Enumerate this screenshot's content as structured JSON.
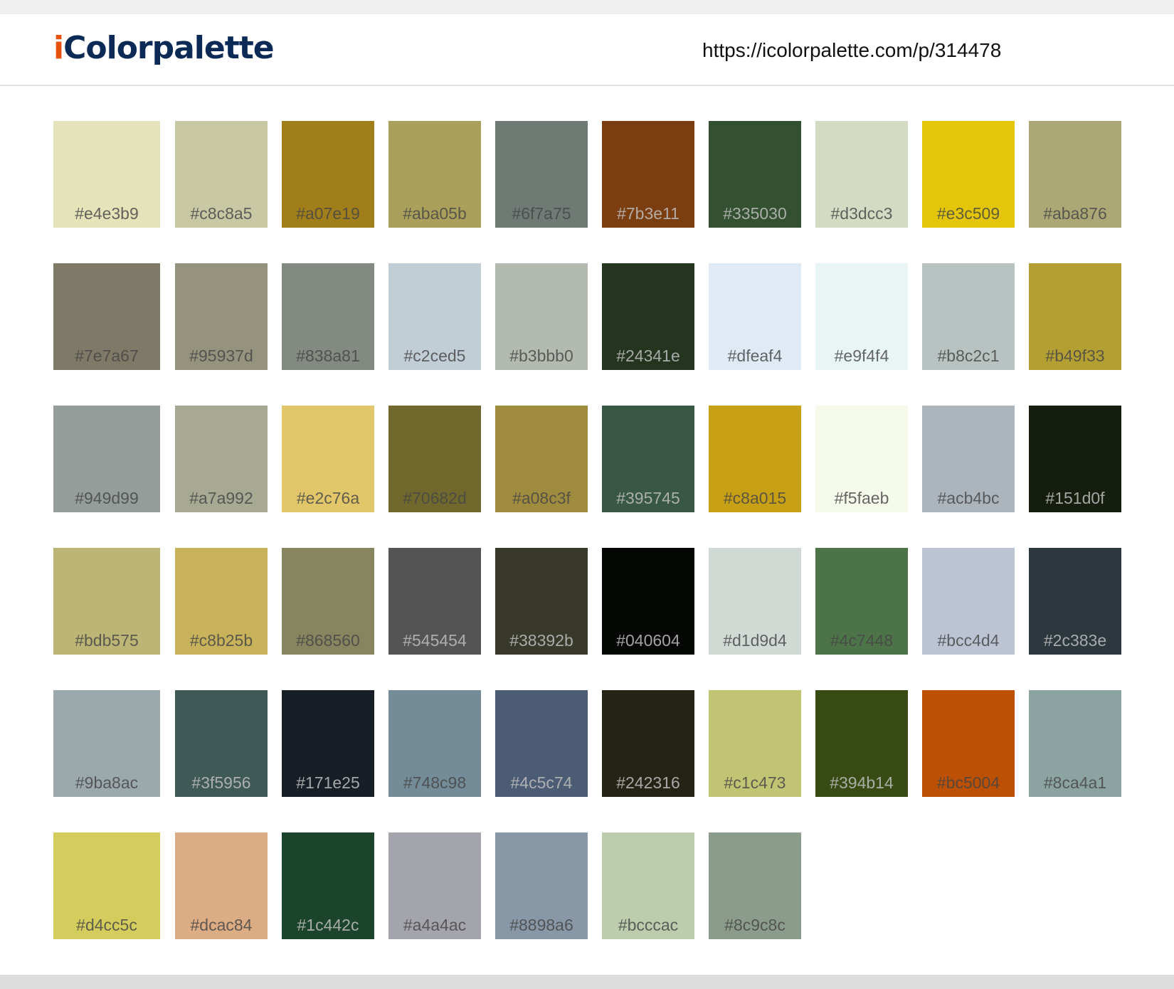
{
  "header": {
    "logo_first": "i",
    "logo_rest": "Colorpalette",
    "url": "https://icolorpalette.com/p/314478"
  },
  "colors": {
    "logo_accent": "#e8520f",
    "logo_main": "#0b2a55"
  },
  "swatches": [
    "#e4e3b9",
    "#c8c8a5",
    "#a07e19",
    "#aba05b",
    "#6f7a75",
    "#7b3e11",
    "#335030",
    "#d3dcc3",
    "#e3c509",
    "#aba876",
    "#7e7a67",
    "#95937d",
    "#838a81",
    "#c2ced5",
    "#b3bbb0",
    "#24341e",
    "#dfeaf4",
    "#e9f4f4",
    "#b8c2c1",
    "#b49f33",
    "#949d99",
    "#a7a992",
    "#e2c76a",
    "#70682d",
    "#a08c3f",
    "#395745",
    "#c8a015",
    "#f5faeb",
    "#acb4bc",
    "#151d0f",
    "#bdb575",
    "#c8b25b",
    "#868560",
    "#545454",
    "#38392b",
    "#040604",
    "#d1d9d4",
    "#4c7448",
    "#bcc4d4",
    "#2c383e",
    "#9ba8ac",
    "#3f5956",
    "#171e25",
    "#748c98",
    "#4c5c74",
    "#242316",
    "#c1c473",
    "#394b14",
    "#bc5004",
    "#8ca4a1",
    "#d4cc5c",
    "#dcac84",
    "#1c442c",
    "#a4a4ac",
    "#8898a6",
    "#bcccac",
    "#8c9c8c"
  ]
}
